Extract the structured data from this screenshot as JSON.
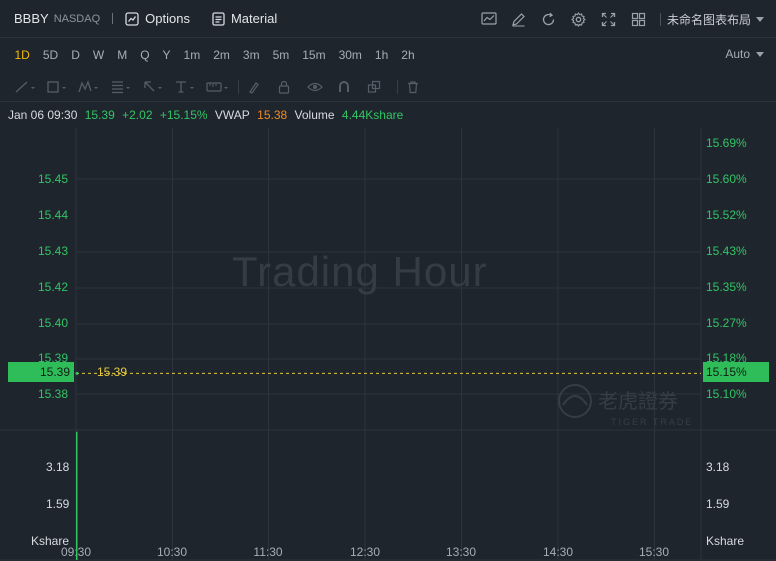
{
  "header": {
    "symbol": "BBBY",
    "exchange": "NASDAQ",
    "options_label": "Options",
    "material_label": "Material",
    "layout_label": "未命名图表布局"
  },
  "periods": [
    "1D",
    "5D",
    "D",
    "W",
    "M",
    "Q",
    "Y",
    "1m",
    "2m",
    "3m",
    "5m",
    "15m",
    "30m",
    "1h",
    "2h"
  ],
  "active_period": "1D",
  "scale_mode": "Auto",
  "info": {
    "datetime": "Jan 06 09:30",
    "price": "15.39",
    "change": "+2.02",
    "change_pct": "+15.15%",
    "vwap_label": "VWAP",
    "vwap": "15.38",
    "volume_label": "Volume",
    "volume": "4.44Kshare"
  },
  "watermark": "Trading Hour",
  "logo_text": "老虎證券",
  "logo_sub": "TIGER TRADE",
  "colors": {
    "up": "#32c464",
    "vwap": "#f08a24",
    "price_line": "#e6c93a",
    "bg": "#1f252d",
    "accent": "#f0b90b"
  },
  "price_axis": [
    "15.45",
    "15.44",
    "15.43",
    "15.42",
    "15.40",
    "15.39",
    "15.38"
  ],
  "pct_axis": [
    "15.69%",
    "15.60%",
    "15.52%",
    "15.43%",
    "15.35%",
    "15.27%",
    "15.18%",
    "15.10%"
  ],
  "volume_axis": {
    "left": [
      "3.18",
      "1.59",
      "Kshare"
    ],
    "right": [
      "3.18",
      "1.59",
      "Kshare"
    ]
  },
  "time_axis": [
    "09:30",
    "10:30",
    "11:30",
    "12:30",
    "13:30",
    "14:30",
    "15:30"
  ],
  "current": {
    "price": "15.39",
    "pct": "15.15%",
    "line_label": "15.39"
  },
  "chart_data": {
    "type": "line",
    "x": [
      "09:30"
    ],
    "series": [
      {
        "values": [
          15.39
        ]
      }
    ],
    "volume": {
      "x": [
        "09:30"
      ],
      "values": [
        4.44
      ]
    },
    "ylim": [
      15.374,
      15.457
    ],
    "ylim_volume": [
      0,
      4.5
    ]
  }
}
